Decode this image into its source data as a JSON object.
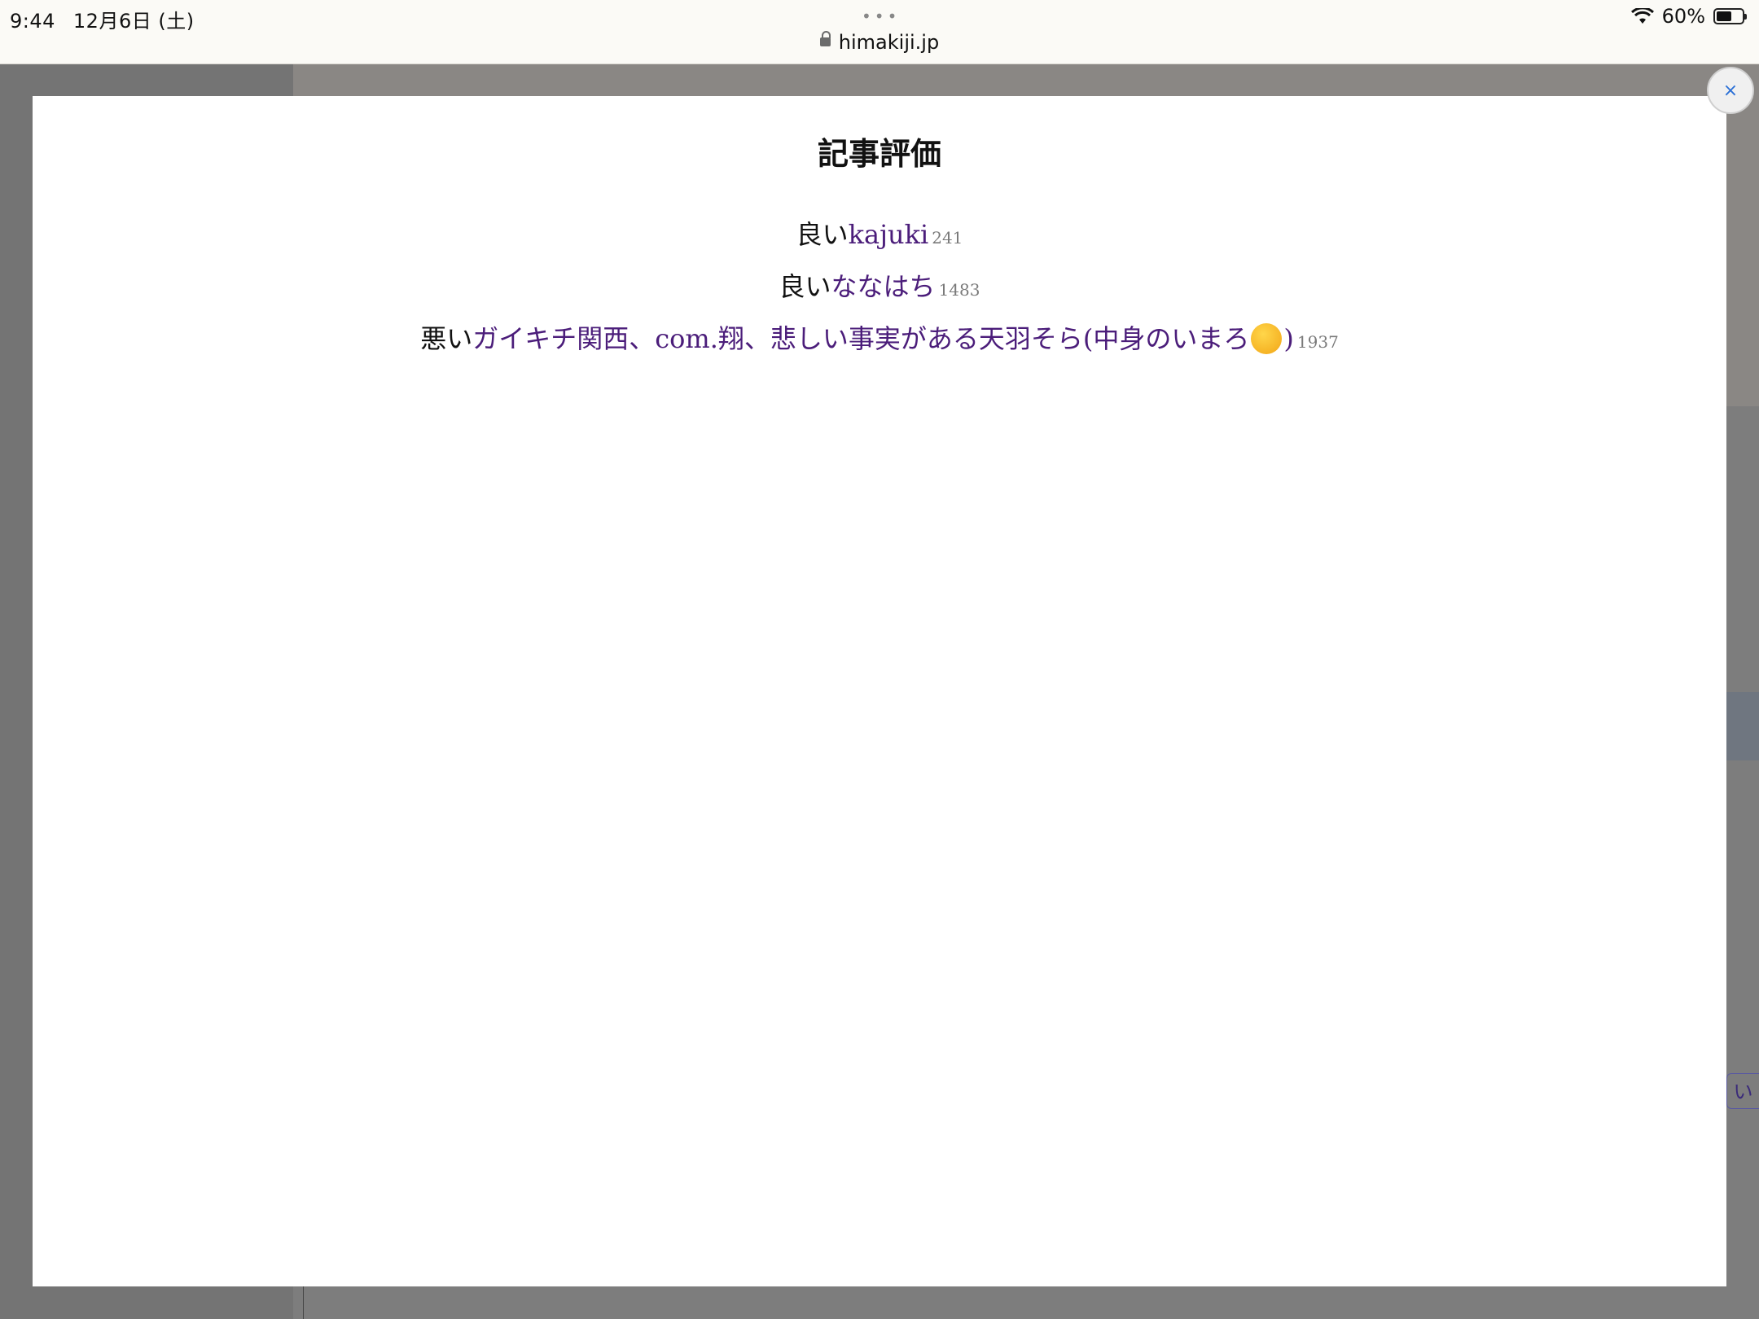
{
  "status_bar": {
    "time": "9:44",
    "date": "12月6日 (土)",
    "battery_percent": "60%",
    "battery_level": 0.6
  },
  "browser": {
    "url": "himakiji.jp",
    "menu_dots": "•••"
  },
  "modal": {
    "title": "記事評価",
    "close_label": "×",
    "ratings": [
      {
        "label": "良い",
        "voter": "kajuki",
        "count": "241"
      },
      {
        "label": "良い",
        "voter": "ななはち",
        "count": "1483"
      },
      {
        "label": "悪い",
        "voter": "ガイキチ関西、com.翔、悲しい事実がある天羽そら(中身のいまろ",
        "voter_suffix": ")",
        "count": "1937"
      }
    ]
  },
  "background": {
    "edge_text": "い"
  },
  "icons": {
    "lock": "lock-icon",
    "wifi": "wifi-icon",
    "battery": "battery-icon",
    "emoji": "kissing-face-emoji"
  }
}
